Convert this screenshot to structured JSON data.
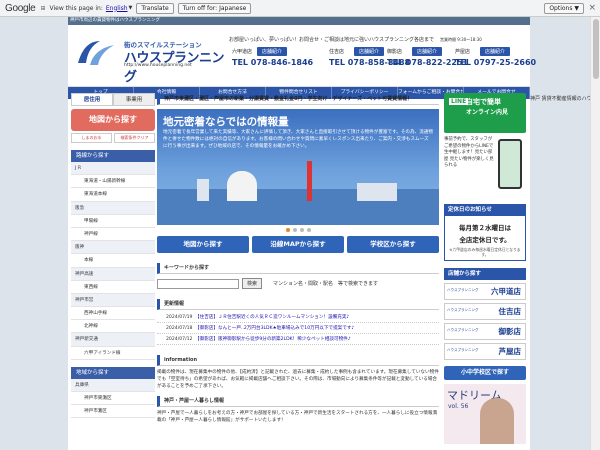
{
  "gbar": {
    "logo": "Google",
    "view_text": "View this page in:",
    "lang_link": "English",
    "translate_label": "Translate",
    "turnoff_label": "Turn off for: Japanese",
    "options_label": "Options ▼",
    "close_glyph": "×"
  },
  "site": {
    "breadcrumb": "神戸市周辺の賃貸物件はハウスプランニング",
    "logo_sub": "街のスマイルステーション",
    "logo_main": "ハウスプランニング",
    "logo_url": "http://www.houseplanning.net",
    "tagline": "お部屋いっぱい、夢いっぱい！お問合せ・ご相談は地元に強いハウスプランニング各店まで",
    "hours": "営業時間 9:30～18:30",
    "stores": [
      {
        "name": "六甲道店",
        "btn": "店舗紹介",
        "tel": "TEL 078-846-1846"
      },
      {
        "name": "住吉店",
        "btn": "店舗紹介",
        "tel": "TEL 078-858-8488"
      },
      {
        "name": "御影店",
        "btn": "店舗紹介",
        "tel": "TEL 078-822-2251"
      },
      {
        "name": "芦屋店",
        "btn": "店舗紹介",
        "tel": "TEL 0797-25-2660"
      }
    ],
    "right_edge_text": "神戸 賃貸不動産情報のハウ"
  },
  "nav": [
    "トップ",
    "会社情報",
    "お問合せ方法",
    "物件問合せリスト",
    "プライバシーポリシー",
    "フォームからご相談・お問合せ",
    "メールでお問合せ"
  ],
  "left": {
    "tab_residential": "居住用",
    "tab_business": "事業用",
    "map_btn": "地図から探す",
    "mini1": "しまのお水",
    "mini2": "検索条件クリア",
    "route_hdr": "路線から探す",
    "routes": [
      {
        "label": "J R",
        "cat": true
      },
      {
        "label": "東海道・山陽新幹線",
        "cat": false
      },
      {
        "label": "東海道本線",
        "cat": false
      },
      {
        "label": "阪急",
        "cat": true
      },
      {
        "label": "甲陽線",
        "cat": false
      },
      {
        "label": "神戸線",
        "cat": false
      },
      {
        "label": "阪神",
        "cat": true
      },
      {
        "label": "本線",
        "cat": false
      },
      {
        "label": "神戸高速",
        "cat": true
      },
      {
        "label": "東西線",
        "cat": false
      },
      {
        "label": "神戸市営",
        "cat": true
      },
      {
        "label": "西神山手線",
        "cat": false
      },
      {
        "label": "北神線",
        "cat": false
      },
      {
        "label": "神戸新交通",
        "cat": true
      },
      {
        "label": "六甲アイランド線",
        "cat": false
      }
    ],
    "area_hdr": "地域から探す",
    "areas": [
      {
        "label": "兵庫県",
        "cat": true
      },
      {
        "label": "神戸市東灘区",
        "cat": false
      },
      {
        "label": "神戸市灘区",
        "cat": false
      }
    ]
  },
  "center": {
    "title": "神戸市東灘区・灘区・芦屋市の新築・分譲賃貸・敷金礼金0円・学生向け・デザイナーズ・ペット可賃貸情報！",
    "hero_h1": "地元密着ならではの情報量",
    "hero_p": "地元密着で長年営業して来た実績等、大家さんに評価して頂き、大家さんと直接取引させて頂ける物件が豊富です。その為、流通物件と併せた物件数には絶対の自信があります。お客様の問い合わせや質問に素早くレスポンス出来たり、ご案内・交渉もスムーズに行う事が出来ます。ぜひ地域の店で、その情報量をお確かめ下さい。",
    "btn_map": "地図から探す",
    "btn_route": "沿線MAPから探す",
    "btn_school": "学校区から探す",
    "kw_title": "キーワードから探す",
    "kw_btn": "検索",
    "kw_hint": "マンション名・間取・駅名　等で検索できます",
    "news_title": "更新情報",
    "news": [
      {
        "date": "2024/07/19",
        "text": "【住吉店】ＪＲ住吉駅近くの人気ＲＣ造ワンルームマンション！設備充実♪"
      },
      {
        "date": "2024/07/18",
        "text": "【御影店】なんと一戸..2万円台3LDK★駐車場込みで10万円以下で提案です♪"
      },
      {
        "date": "2024/07/12",
        "text": "【御影店】阪神御影駅から徒歩9分の新築2LDK！稀少なペット相談可物件♪"
      }
    ],
    "info_title": "information",
    "info_text": "掲載の物件は、現在募集中の物件の他、【成約済】と記載された、過去に募集・成約した事例も含まれています。現在募集していない物件でも「空室待ち」の希望があれば、お気軽に掲載店舗へご相談下さい。その際は、市場動向により募集条件等が記載と変動している場合があることを予めご了承下さい。",
    "single_title": "神戸・芦屋一人暮らし情報",
    "single_text": "神戸・芦屋で一人暮らしをお考えの方・神戸でお部屋を探している方・神戸で新生活をスタートされる方を、一人暮らしに役立つ情報満載の「神戸・芦屋一人暮らし情報館」がサポートいたします！"
  },
  "right": {
    "line_a": "LINE",
    "line_b1": "自宅で簡単",
    "line_b2": "オンライン内見",
    "phone_txt": "事前予約で、スタッフがご希望の物件からLINEで生中継します！見たい部屋 見たい物件が楽しく見られる",
    "holiday_hdr": "定休日のお知らせ",
    "holiday_m1": "毎月第２水曜日は",
    "holiday_m2": "全店定休日です。",
    "holiday_note": "※六甲道店のみ毎週水曜日定休日となります。",
    "shop_hdr": "店舗から探す",
    "shops": [
      "六甲道店",
      "住吉店",
      "御影店",
      "芦屋店"
    ],
    "shop_logo": "ハウスプランニング",
    "school_btn": "小中学校区で探す",
    "mag_title": "マドリーム",
    "mag_vol": "vol. 56"
  }
}
